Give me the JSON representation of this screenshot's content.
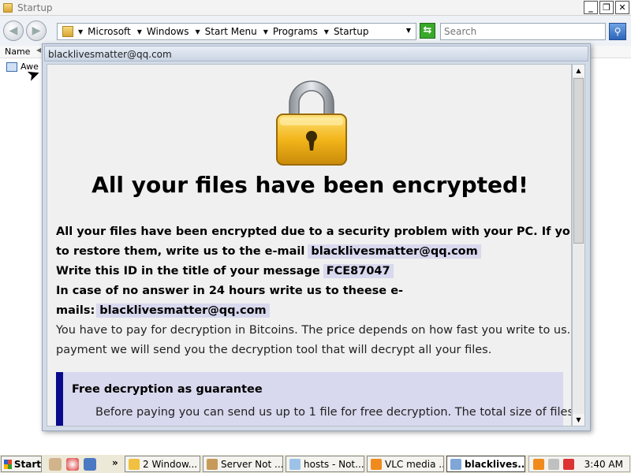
{
  "explorer": {
    "title": "Startup",
    "breadcrumbs": [
      "Microsoft",
      "Windows",
      "Start Menu",
      "Programs",
      "Startup"
    ],
    "search_placeholder": "Search",
    "column_name": "Name",
    "file_item": "Awe"
  },
  "note": {
    "window_title": "blacklivesmatter@qq.com",
    "headline": "All your files have been encrypted!",
    "line1": "All your files have been encrypted due to a security problem with your PC. If you want",
    "line2": "to restore them, write us to the e-mail",
    "email": "blacklivesmatter@qq.com",
    "line3": "Write this ID in the title of your message",
    "id": "FCE87047",
    "line4": "In case of no answer in 24 hours write us to theese e-",
    "line5": "mails:",
    "email2": "blacklivesmatter@qq.com",
    "line6": "You have to pay for decryption in Bitcoins. The price depends on how fast you write to us. After",
    "line7": "payment we will send you the decryption tool that will decrypt all your files.",
    "guarantee_title": "Free decryption as guarantee",
    "guarantee_text": "Before paying you can send us up to 1 file for free decryption. The total size of files must"
  },
  "taskbar": {
    "start_label": "Start",
    "tasks": [
      "2 Window...",
      "Server Not ...",
      "hosts - Not...",
      "VLC media ...",
      "blacklives..."
    ],
    "clock": "3:40 AM",
    "overflow": "»"
  },
  "colors": {
    "highlight": "#d8d8ee",
    "guarantee_bar": "#0a0a8c",
    "lock_gold": "#f2b51a"
  }
}
